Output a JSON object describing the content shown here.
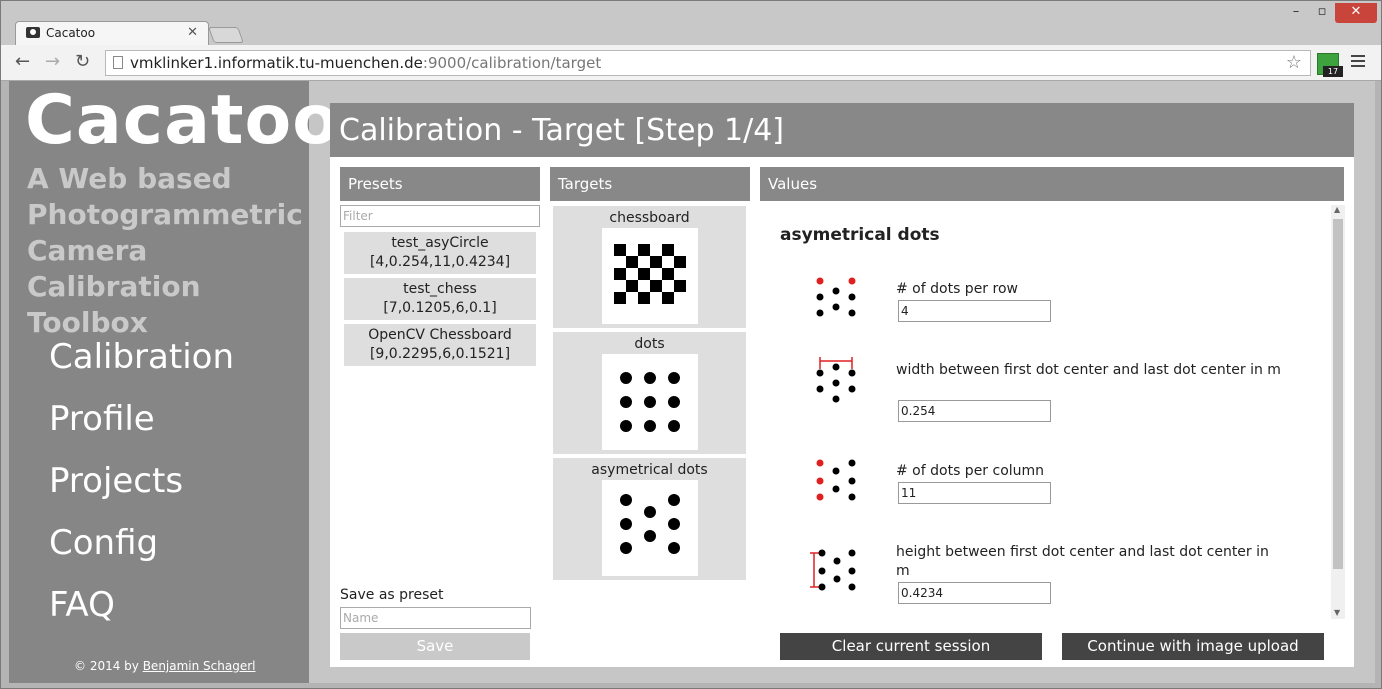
{
  "browser": {
    "tab_title": "Cacatoo",
    "url_host": "vmklinker1.informatik.tu-muenchen.de",
    "url_path": ":9000/calibration/target",
    "ext_badge": "17"
  },
  "sidebar": {
    "logo": "Cacatoo",
    "tagline": "A Web based Photogrammetric Camera Calibration Toolbox",
    "nav": [
      "Calibration",
      "Profile",
      "Projects",
      "Config",
      "FAQ"
    ],
    "copyright_prefix": "© 2014 by ",
    "copyright_author": "Benjamin Schagerl"
  },
  "main": {
    "title": "Calibration - Target [Step 1/4]",
    "presets": {
      "heading": "Presets",
      "filter_placeholder": "Filter",
      "items": [
        {
          "name": "test_asyCircle",
          "params": "[4,0.254,11,0.4234]"
        },
        {
          "name": "test_chess",
          "params": "[7,0.1205,6,0.1]"
        },
        {
          "name": "OpenCV Chessboard",
          "params": "[9,0.2295,6,0.1521]"
        }
      ],
      "save_label": "Save as preset",
      "name_placeholder": "Name",
      "save_button": "Save"
    },
    "targets": {
      "heading": "Targets",
      "items": [
        "chessboard",
        "dots",
        "asymetrical dots"
      ]
    },
    "values": {
      "heading": "Values",
      "title": "asymetrical dots",
      "fields": [
        {
          "label": "# of dots per row",
          "value": "4"
        },
        {
          "label": "width between first dot center and last dot center in m",
          "value": "0.254"
        },
        {
          "label": "# of dots per column",
          "value": "11"
        },
        {
          "label": "height between first dot center and last dot center in m",
          "value": "0.4234"
        }
      ]
    },
    "buttons": {
      "clear": "Clear current session",
      "continue": "Continue with image upload"
    }
  },
  "colors": {
    "sidebar_bg": "#868686",
    "header_bg": "#888888",
    "button_dark": "#444444",
    "highlight_dot": "#e02020"
  }
}
